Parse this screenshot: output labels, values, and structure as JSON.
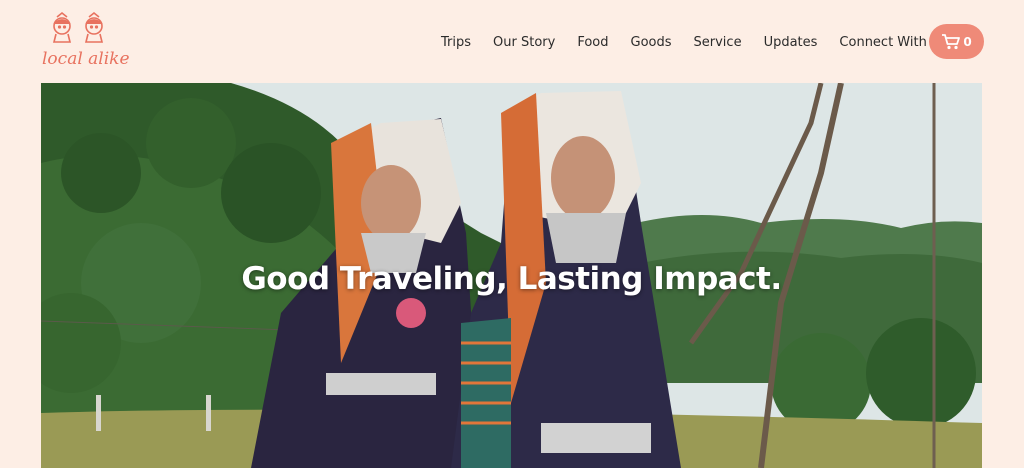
{
  "brand": {
    "name": "local alike"
  },
  "nav": {
    "items": [
      "Trips",
      "Our Story",
      "Food",
      "Goods",
      "Service",
      "Updates",
      "Connect With Us"
    ]
  },
  "cart": {
    "count": "0",
    "icon": "cart-icon"
  },
  "hero": {
    "title": "Good Traveling, Lasting Impact."
  },
  "colors": {
    "background": "#fdeee5",
    "accent": "#ef8a78",
    "logo": "#e8725f"
  }
}
